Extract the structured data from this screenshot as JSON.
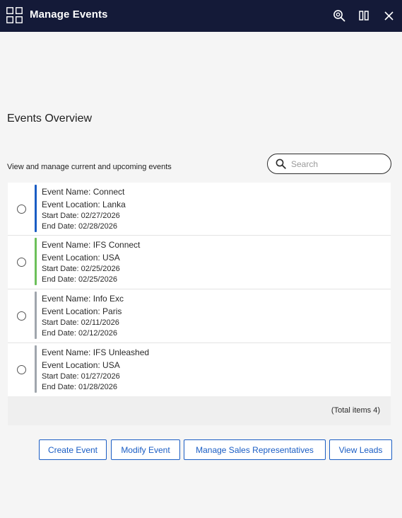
{
  "titlebar": {
    "title": "Manage Events",
    "icons": [
      "grid-app-icon",
      "zoom-icon",
      "split-view-icon",
      "close-icon"
    ]
  },
  "main": {
    "heading": "Events Overview",
    "subtitle": "View and manage current and upcoming events",
    "search": {
      "placeholder": "Search",
      "value": ""
    }
  },
  "events": [
    {
      "name": "Event Name: Connect",
      "location": "Event Location: Lanka",
      "start": "Start Date: 02/27/2026",
      "end": "End Date: 02/28/2026",
      "status_color": "#1a5dc4"
    },
    {
      "name": "Event Name: IFS Connect",
      "location": "Event Location: USA",
      "start": "Start Date: 02/25/2026",
      "end": "End Date: 02/25/2026",
      "status_color": "#6cc05a"
    },
    {
      "name": "Event Name: Info Exc",
      "location": "Event Location: Paris",
      "start": "Start Date: 02/11/2026",
      "end": "End Date: 02/12/2026",
      "status_color": "#a0a6ad"
    },
    {
      "name": "Event Name: IFS Unleashed",
      "location": "Event Location: USA",
      "start": "Start Date: 01/27/2026",
      "end": "End Date: 01/28/2026",
      "status_color": "#a0a6ad"
    }
  ],
  "footer": {
    "total": "(Total items 4)"
  },
  "actions": {
    "create": "Create Event",
    "modify": "Modify Event",
    "manage_reps": "Manage Sales Representatives",
    "view_leads": "View Leads"
  },
  "colors": {
    "titlebar_bg": "#141a38",
    "accent": "#1a5dc4",
    "page_bg": "#f5f5f5"
  }
}
